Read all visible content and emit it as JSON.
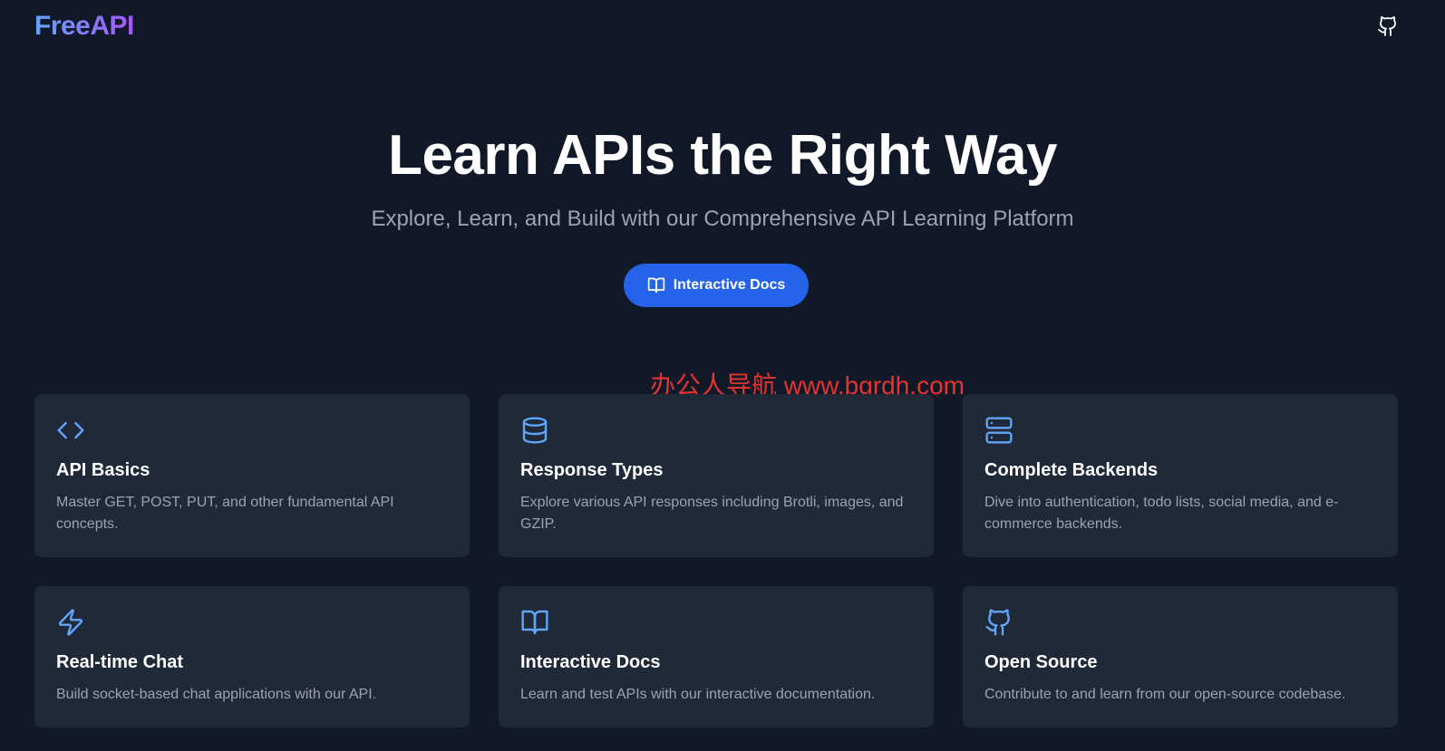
{
  "header": {
    "logo": "FreeAPI",
    "github_icon": "github-icon"
  },
  "hero": {
    "title": "Learn APIs the Right Way",
    "subtitle": "Explore, Learn, and Build with our Comprehensive API Learning Platform",
    "cta_label": "Interactive Docs",
    "cta_icon": "book-open-icon"
  },
  "watermark": "办公人导航  www.bgrdh.com",
  "colors": {
    "background": "#111827",
    "card": "#1f2937",
    "accent": "#2563eb",
    "icon": "#60a5fa",
    "muted_text": "#9ca3af",
    "logo_gradient": [
      "#60a5fa",
      "#a855f7"
    ],
    "watermark": "#e3342f"
  },
  "features": [
    {
      "icon": "code-icon",
      "title": "API Basics",
      "description": "Master GET, POST, PUT, and other fundamental API concepts."
    },
    {
      "icon": "database-icon",
      "title": "Response Types",
      "description": "Explore various API responses including Brotli, images, and GZIP."
    },
    {
      "icon": "server-icon",
      "title": "Complete Backends",
      "description": "Dive into authentication, todo lists, social media, and e-commerce backends."
    },
    {
      "icon": "lightning-icon",
      "title": "Real-time Chat",
      "description": "Build socket-based chat applications with our API."
    },
    {
      "icon": "book-open-icon",
      "title": "Interactive Docs",
      "description": "Learn and test APIs with our interactive documentation."
    },
    {
      "icon": "github-icon",
      "title": "Open Source",
      "description": "Contribute to and learn from our open-source codebase."
    }
  ]
}
